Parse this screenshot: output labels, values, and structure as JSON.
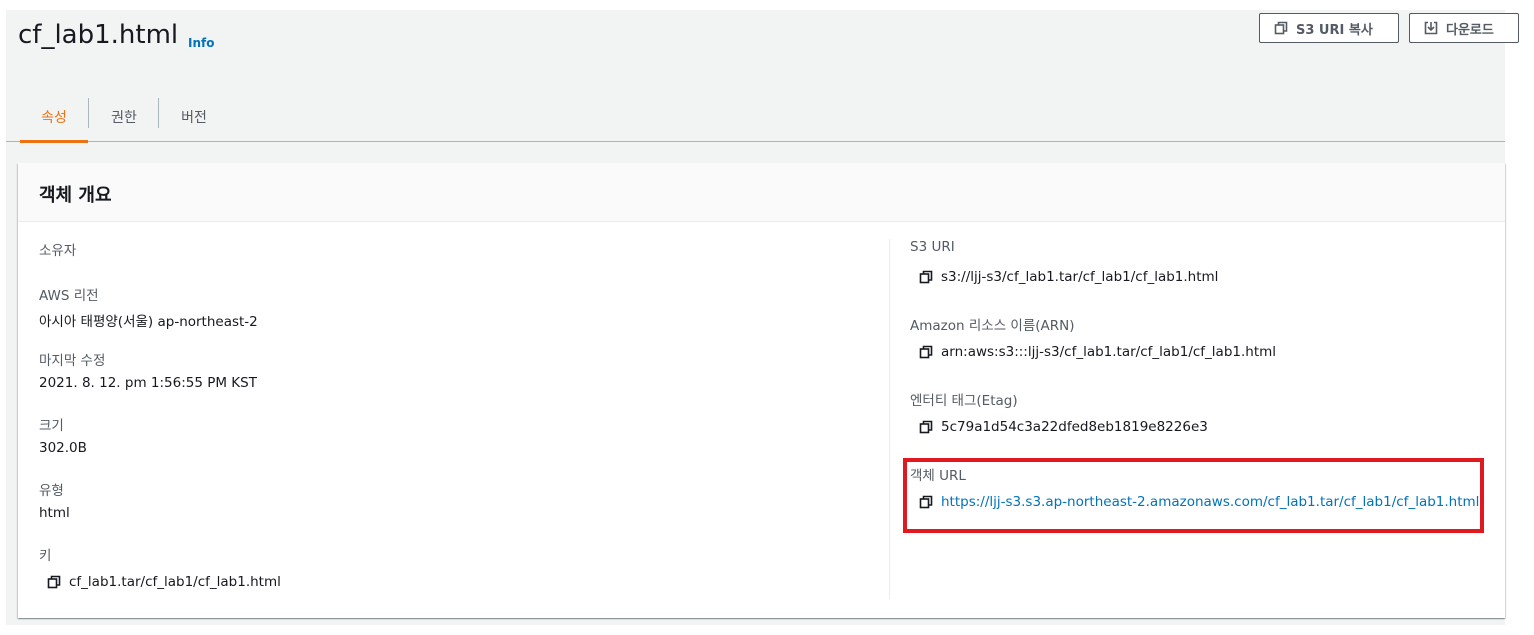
{
  "header": {
    "title": "cf_lab1.html",
    "info_label": "Info",
    "copy_uri_button": "S3 URI 복사",
    "download_button": "다운로드"
  },
  "tabs": [
    {
      "label": "속성",
      "active": true
    },
    {
      "label": "권한",
      "active": false
    },
    {
      "label": "버전",
      "active": false
    }
  ],
  "overview": {
    "title": "객체 개요",
    "left": {
      "owner_label": "소유자",
      "region_label": "AWS 리전",
      "region_value": "아시아 태평양(서울) ap-northeast-2",
      "modified_label": "마지막 수정",
      "modified_value": "2021. 8. 12. pm 1:56:55 PM KST",
      "size_label": "크기",
      "size_value": "302.0B",
      "type_label": "유형",
      "type_value": "html",
      "key_label": "키",
      "key_value": "cf_lab1.tar/cf_lab1/cf_lab1.html"
    },
    "right": {
      "s3uri_label": "S3 URI",
      "s3uri_value": "s3://ljj-s3/cf_lab1.tar/cf_lab1/cf_lab1.html",
      "arn_label": "Amazon 리소스 이름(ARN)",
      "arn_value": "arn:aws:s3:::ljj-s3/cf_lab1.tar/cf_lab1/cf_lab1.html",
      "etag_label": "엔터티 태그(Etag)",
      "etag_value": "5c79a1d54c3a22dfed8eb1819e8226e3",
      "url_label": "객체 URL",
      "url_value": "https://ljj-s3.s3.ap-northeast-2.amazonaws.com/cf_lab1.tar/cf_lab1/cf_lab1.html"
    }
  },
  "colors": {
    "accent": "#ec7211",
    "link": "#0073bb",
    "highlight": "#e0181f"
  },
  "icons": {
    "copy": "copy-icon",
    "download": "download-icon"
  }
}
